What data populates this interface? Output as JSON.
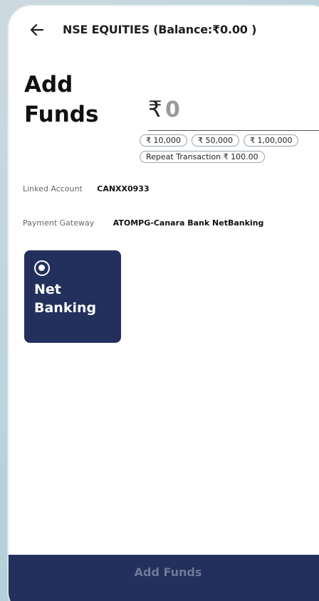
{
  "header": {
    "title": "NSE EQUITIES (Balance:₹0.00 )"
  },
  "main": {
    "title": "Add Funds",
    "currency_symbol": "₹",
    "amount_value": "0",
    "quick_amounts": [
      "₹ 10,000",
      "₹ 50,000",
      "₹ 1,00,000"
    ],
    "repeat_transaction": "Repeat Transaction ₹ 100.00",
    "linked_account_label": "Linked Account",
    "linked_account_value": "CANXX0933",
    "payment_gateway_label": "Payment Gateway",
    "payment_gateway_value": "ATOMPG-Canara Bank NetBanking",
    "payment_method": "Net Banking"
  },
  "footer": {
    "button_label": "Add Funds"
  },
  "colors": {
    "primary": "#22305b",
    "button_text_disabled": "#6f7a99"
  },
  "icons": {
    "back": "arrow-left-icon",
    "radio": "radio-selected-icon"
  }
}
